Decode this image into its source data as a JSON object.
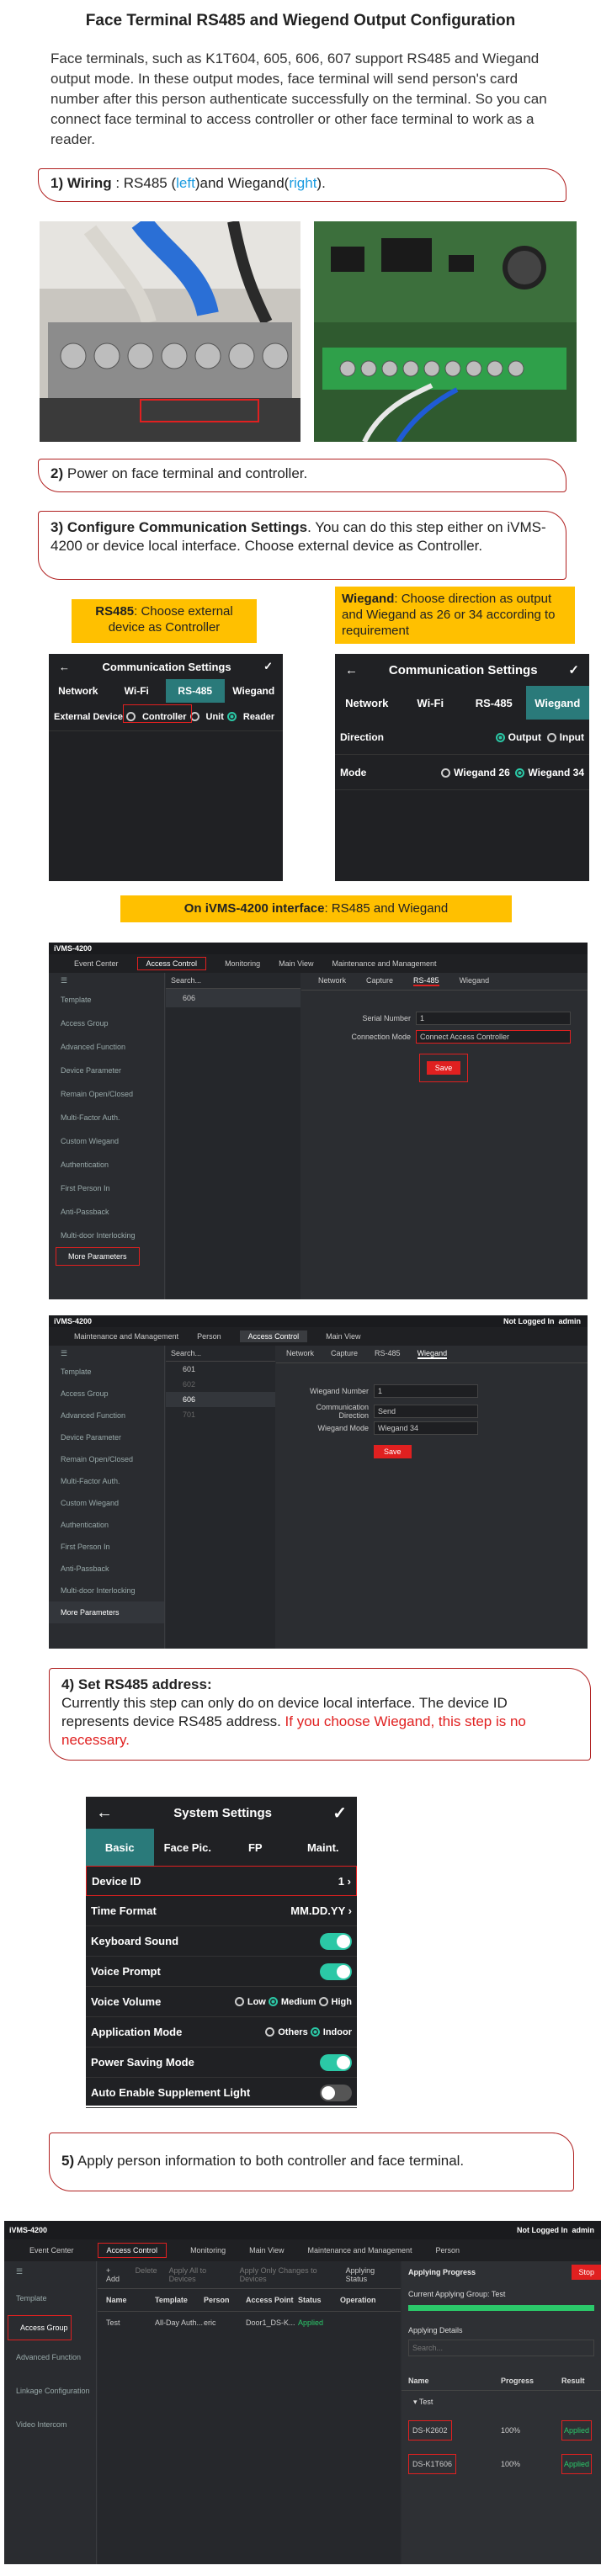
{
  "title": "Face Terminal  RS485 and Wiegend Output Configuration",
  "intro": "Face terminals, such as K1T604, 605, 606, 607 support RS485  and Wiegand output mode. In these output modes, face terminal will send person's card number after this person authenticate successfully on the terminal. So you can connect face terminal to access controller or other face terminal to work as a reader.",
  "step1": {
    "num": "1)",
    "label": "Wiring",
    "a": " : RS485 (",
    "left": "left",
    "b": ")and Wiegand(",
    "right": "right",
    "c": ")."
  },
  "step2": {
    "num": "2)",
    "text": "Power on face terminal and controller."
  },
  "step3": {
    "num": "3)",
    "label": "Configure Communication Settings",
    "text": ". You can do this step either on  iVMS-4200 or device local interface. Choose external device as Controller."
  },
  "rs485_note": {
    "label": "RS485",
    "text": ": Choose external device as Controller"
  },
  "wiegand_note": {
    "label": "Wiegand",
    "text": ": Choose direction as output and Wiegand as 26 or 34 according to requirement"
  },
  "comm1": {
    "title": "Communication Settings",
    "tabs": [
      "Network",
      "Wi-Fi",
      "RS-485",
      "Wiegand"
    ],
    "row_label": "External Device",
    "opt1": "Controller",
    "opt2": "Unit",
    "opt3": "Reader"
  },
  "comm2": {
    "title": "Communication Settings",
    "tabs": [
      "Network",
      "Wi-Fi",
      "RS-485",
      "Wiegand"
    ],
    "dir_label": "Direction",
    "dir_out": "Output",
    "dir_in": "Input",
    "mode_label": "Mode",
    "mode_26": "Wiegand 26",
    "mode_34": "Wiegand 34"
  },
  "ivms_note": {
    "label": "On iVMS-4200 interface",
    "text": ": RS485 and Wiegand"
  },
  "ivms1": {
    "app": "iVMS-4200",
    "nav": [
      "Event Center",
      "Access Control",
      "Monitoring",
      "Main View",
      "Maintenance and Management"
    ],
    "search": "Search...",
    "device": "606",
    "tabs": [
      "Network",
      "Capture",
      "RS-485",
      "Wiegand"
    ],
    "f1": "Serial Number",
    "v1": "1",
    "f2": "Connection Mode",
    "v2": "Connect Access Controller",
    "save": "Save",
    "side": [
      "Template",
      "Access Group",
      "Advanced Function",
      "Device Parameter",
      "Remain Open/Closed",
      "Multi-Factor Auth.",
      "Custom Wiegand",
      "Authentication",
      "First Person In",
      "Anti-Passback",
      "Multi-door Interlocking",
      "More Parameters"
    ]
  },
  "ivms2": {
    "app": "iVMS-4200",
    "nav": [
      "Maintenance and Management",
      "Person",
      "Access Control",
      "Main View"
    ],
    "login": "Not Logged In",
    "user": "admin",
    "search": "Search...",
    "devices": [
      "601",
      "602",
      "606",
      "701"
    ],
    "tabs": [
      "Network",
      "Capture",
      "RS-485",
      "Wiegand"
    ],
    "f1": "Wiegand Number",
    "v1": "1",
    "f2": "Communication Direction",
    "v2": "Send",
    "f3": "Wiegand Mode",
    "v3": "Wiegand 34",
    "save": "Save",
    "side": [
      "Template",
      "Access Group",
      "Advanced Function",
      "Device Parameter",
      "Remain Open/Closed",
      "Multi-Factor Auth.",
      "Custom Wiegand",
      "Authentication",
      "First Person In",
      "Anti-Passback",
      "Multi-door Interlocking",
      "More Parameters"
    ]
  },
  "step4": {
    "num": "4)",
    "label": "Set RS485 address:",
    "text": "Currently this step can only do on device local interface. The device ID represents  device RS485 address. ",
    "red": "If you choose Wiegand, this step is no necessary."
  },
  "sys": {
    "title": "System Settings",
    "tabs": [
      "Basic",
      "Face Pic.",
      "FP",
      "Maint."
    ],
    "rows": [
      [
        "Device ID",
        "1"
      ],
      [
        "Time Format",
        "MM.DD.YY"
      ],
      [
        "Keyboard Sound",
        ""
      ],
      [
        "Voice Prompt",
        ""
      ],
      [
        "Voice Volume",
        ""
      ],
      [
        "Application Mode",
        ""
      ],
      [
        "Power Saving Mode",
        ""
      ],
      [
        "Auto Enable Supplement Light",
        ""
      ]
    ],
    "vol": [
      "Low",
      "Medium",
      "High"
    ],
    "app": [
      "Others",
      "Indoor"
    ]
  },
  "step5": {
    "num": "5)",
    "text": " Apply person information to both controller and face terminal."
  },
  "ivms3": {
    "app": "iVMS-4200",
    "login": "Not Logged In",
    "user": "admin",
    "nav": [
      "Event Center",
      "Access Control",
      "Monitoring",
      "Main View",
      "Maintenance and Management",
      "Person"
    ],
    "toolbar": [
      "+ Add",
      "Delete",
      "Apply All to Devices",
      "Apply Only Changes to Devices",
      "Applying Status"
    ],
    "cols": [
      "Name",
      "Template",
      "Person",
      "Access Point",
      "Status",
      "Operation"
    ],
    "row": [
      "Test",
      "All-Day Auth...",
      "eric",
      "Door1_DS-K...",
      "Applied"
    ],
    "side": [
      "Template",
      "Access Group",
      "Advanced Function",
      "Linkage Configuration",
      "Video Intercom"
    ],
    "panel_title": "Applying Progress",
    "current": "Current Applying Group: Test",
    "details": "Applying Details",
    "search": "Search...",
    "pcols": [
      "Name",
      "Progress",
      "Result"
    ],
    "group": "Test",
    "prow1": [
      "DS-K2602",
      "100%",
      "Applied"
    ],
    "prow2": [
      "DS-K1T606",
      "100%",
      "Applied"
    ],
    "close": "Stop"
  }
}
